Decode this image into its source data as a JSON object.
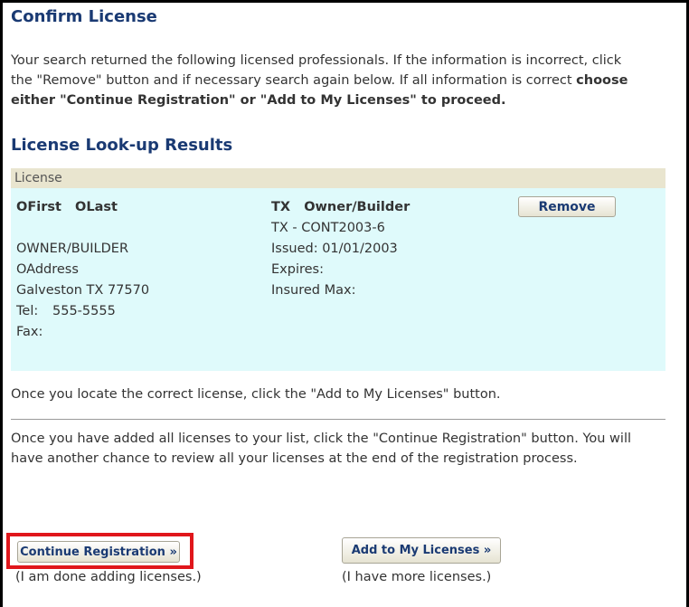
{
  "page": {
    "title": "Confirm License",
    "intro_part1": "Your search returned the following licensed professionals. If the information is incorrect, click the \"Remove\" button and if necessary search again below. If all information is correct ",
    "intro_bold": "choose either \"Continue Registration\" or \"Add to My Licenses\" to proceed.",
    "results_title": "License Look-up Results"
  },
  "license_table": {
    "header": "License",
    "record": {
      "name": "OFirst   OLast",
      "blank": "",
      "category": "OWNER/BUILDER",
      "address": "OAddress",
      "city_state_zip": "Galveston TX 77570",
      "tel_label": "Tel:",
      "tel_value": "555-5555",
      "fax_label": "Fax:",
      "license_type": "TX   Owner/Builder",
      "license_number": "TX - CONT2003-6",
      "issued": "Issued: 01/01/2003",
      "expires": "Expires:",
      "insured_max": "Insured Max:",
      "remove_label": "Remove"
    }
  },
  "notes": {
    "locate": "Once you locate the correct license, click the \"Add to My Licenses\" button.",
    "added": "Once you have added all licenses to your list, click the \"Continue Registration\" button. You will have another chance to review all your licenses at the end of the registration process."
  },
  "actions": {
    "continue_label": "Continue Registration »",
    "continue_hint": "(I am done adding licenses.)",
    "add_label": "Add to My Licenses »",
    "add_hint": "(I have more licenses.)"
  },
  "colors": {
    "heading": "#1a3a73",
    "table_header_bg": "#e9e5cf",
    "record_bg": "#dffafb",
    "highlight": "#e0161b"
  }
}
